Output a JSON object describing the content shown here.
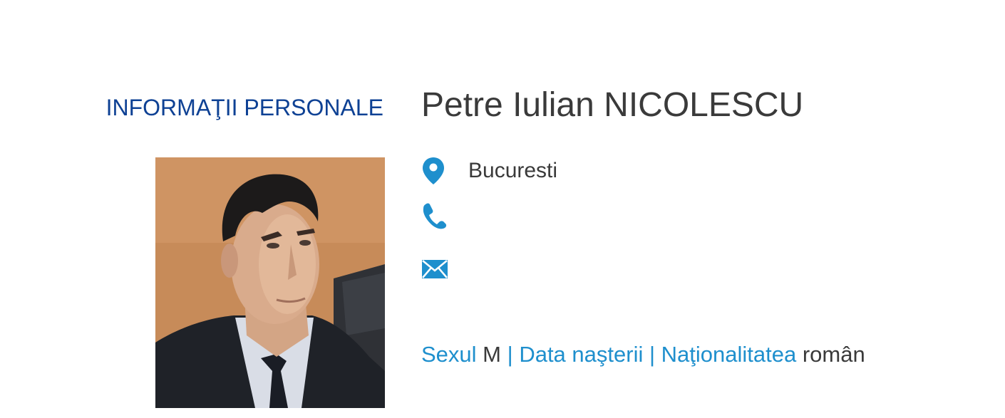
{
  "section": {
    "heading": "INFORMAŢII PERSONALE"
  },
  "person": {
    "name": "Petre Iulian NICOLESCU",
    "photo_icon": "portrait-photo"
  },
  "contact": {
    "location": "Bucuresti",
    "phone": "",
    "email": "",
    "icons": {
      "location": "map-pin-icon",
      "phone": "phone-icon",
      "email": "envelope-icon"
    }
  },
  "personal": {
    "sex_label": "Sexul",
    "sex_value": "M",
    "separator": "|",
    "birth_label": "Data naşterii",
    "birth_value": "",
    "nationality_label": "Naţionalitatea",
    "nationality_value": "român"
  },
  "colors": {
    "heading": "#0e4194",
    "accent": "#1e8fcd",
    "text": "#3a3a3a"
  }
}
